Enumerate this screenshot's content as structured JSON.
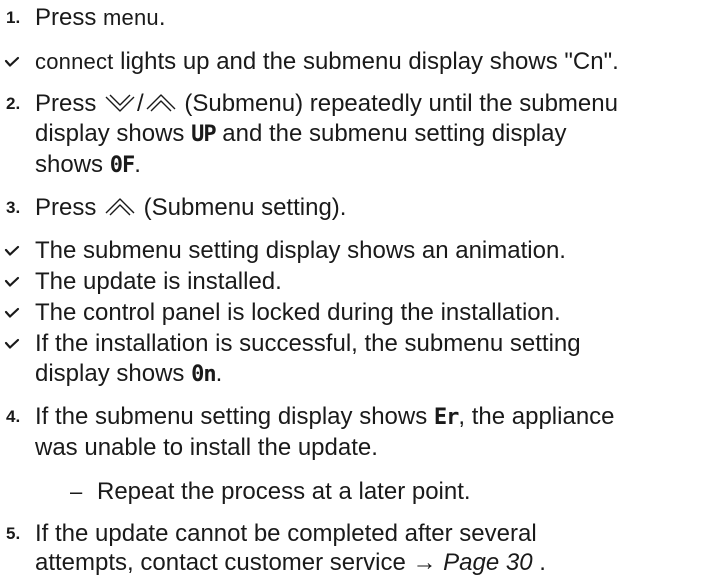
{
  "steps": [
    {
      "num": "1.",
      "text_a": "Press ",
      "key": "menu",
      "text_b": "."
    },
    {
      "check": true,
      "key": "connect",
      "text": " lights up and the submenu display shows \"Cn\"."
    },
    {
      "num": "2.",
      "line1_a": "Press ",
      "line1_sep": "/",
      "line1_b": " (Submenu) repeatedly until the submenu",
      "line2_a": "display shows ",
      "seg_up": "UP",
      "line2_b": " and the submenu setting display",
      "line3_a": "shows ",
      "seg_of": "0F",
      "line3_b": "."
    },
    {
      "num": "3.",
      "text_a": "Press ",
      "text_b": " (Submenu setting)."
    },
    {
      "check": true,
      "text": "The submenu setting display shows an animation."
    },
    {
      "check": true,
      "text": "The update is installed."
    },
    {
      "check": true,
      "text": "The control panel is locked during the installation."
    },
    {
      "check": true,
      "line1": "If the installation is successful, the submenu setting",
      "line2_a": "display shows ",
      "seg_on": "0n",
      "line2_b": "."
    },
    {
      "num": "4.",
      "line1_a": "If the submenu setting display shows ",
      "seg_er": "Er",
      "line1_b": ", the appliance",
      "line2": "was unable to install the update."
    },
    {
      "dash": "–",
      "text": "Repeat the process at a later point."
    },
    {
      "num": "5.",
      "line1": "If the update cannot be completed after several",
      "line2_a": "attempts, contact customer service → ",
      "ref": "Page 30",
      "line2_b": " ."
    }
  ]
}
